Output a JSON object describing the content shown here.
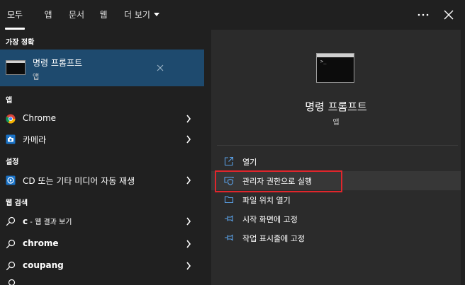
{
  "tabs": [
    {
      "label": "모두",
      "active": true
    },
    {
      "label": "앱"
    },
    {
      "label": "문서"
    },
    {
      "label": "웹"
    },
    {
      "label": "더 보기"
    }
  ],
  "left": {
    "best_match_header": "가장 정확",
    "best_match": {
      "title": "명령 프롬프트",
      "subtitle": "앱"
    },
    "apps_header": "앱",
    "apps": [
      {
        "label": "Chrome"
      },
      {
        "label": "카메라"
      }
    ],
    "settings_header": "설정",
    "settings": [
      {
        "label": "CD 또는 기타 미디어 자동 재생"
      }
    ],
    "web_header": "웹 검색",
    "web": [
      {
        "query": "c",
        "suffix": " - 웹 결과 보기"
      },
      {
        "query": "chrome"
      },
      {
        "query": "coupang"
      }
    ]
  },
  "right": {
    "app_title": "명령 프롬프트",
    "app_subtitle": "앱",
    "actions": [
      {
        "label": "열기",
        "icon": "open-icon"
      },
      {
        "label": "관리자 권한으로 실행",
        "icon": "shield-icon"
      },
      {
        "label": "파일 위치 열기",
        "icon": "folder-icon"
      },
      {
        "label": "시작 화면에 고정",
        "icon": "pin-icon"
      },
      {
        "label": "작업 표시줄에 고정",
        "icon": "pin-icon"
      }
    ]
  },
  "colors": {
    "background": "#202020",
    "panel": "#2b2b2b",
    "selected": "#1e4a6e",
    "highlight": "#e0262c"
  }
}
